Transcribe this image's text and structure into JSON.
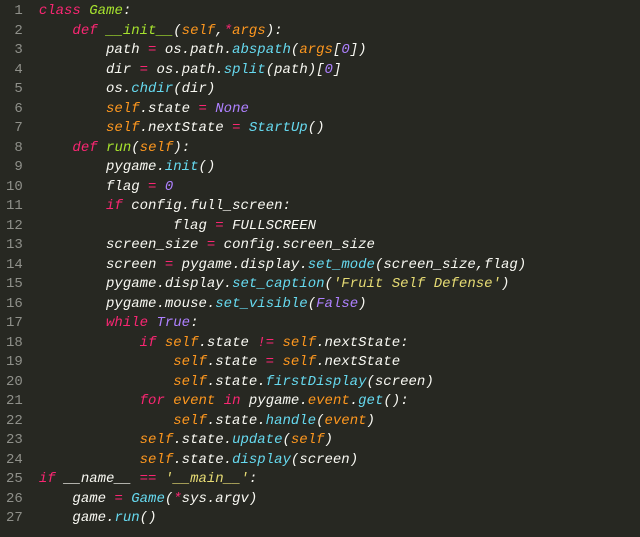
{
  "code": {
    "lines": [
      "class Game:",
      "    def __init__(self,*args):",
      "        path = os.path.abspath(args[0])",
      "        dir = os.path.split(path)[0]",
      "        os.chdir(dir)",
      "        self.state = None",
      "        self.nextState = StartUp()",
      "    def run(self):",
      "        pygame.init()",
      "        flag = 0",
      "        if config.full_screen:",
      "                flag = FULLSCREEN",
      "        screen_size = config.screen_size",
      "        screen = pygame.display.set_mode(screen_size,flag)",
      "        pygame.display.set_caption('Fruit Self Defense')",
      "        pygame.mouse.set_visible(False)",
      "        while True:",
      "            if self.state != self.nextState:",
      "                self.state = self.nextState",
      "                self.state.firstDisplay(screen)",
      "            for event in pygame.event.get():",
      "                self.state.handle(event)",
      "            self.state.update(self)",
      "            self.state.display(screen)",
      "if __name__ == '__main__':",
      "    game = Game(*sys.argv)",
      "    game.run()"
    ]
  },
  "chart_data": {
    "type": "table",
    "title": "Python source: Game class",
    "language": "python",
    "definitions": [
      "Game",
      "Game.__init__",
      "Game.run"
    ],
    "calls": [
      "os.path.abspath",
      "os.path.split",
      "os.chdir",
      "StartUp",
      "pygame.init",
      "pygame.display.set_mode",
      "pygame.display.set_caption",
      "pygame.mouse.set_visible",
      "pygame.event.get",
      "self.state.firstDisplay",
      "self.state.handle",
      "self.state.update",
      "self.state.display",
      "Game",
      "game.run"
    ],
    "string_literals": [
      "Fruit Self Defense",
      "__main__"
    ],
    "line_count": 27
  }
}
